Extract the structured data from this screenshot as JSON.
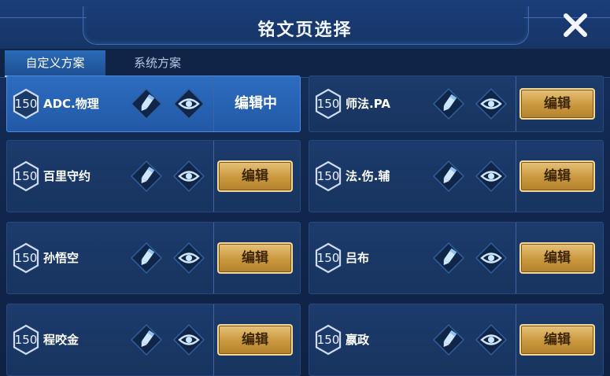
{
  "header": {
    "title": "铭文页选择"
  },
  "tabs": [
    {
      "label": "自定义方案",
      "active": true
    },
    {
      "label": "系统方案",
      "active": false
    }
  ],
  "pages": [
    {
      "level": "150",
      "name": "ADC.物理",
      "selected": true,
      "action_label": "编辑中"
    },
    {
      "level": "150",
      "name": "师法.PA",
      "selected": false,
      "action_label": "编辑"
    },
    {
      "level": "150",
      "name": "百里守约",
      "selected": false,
      "action_label": "编辑"
    },
    {
      "level": "150",
      "name": "法.伤.辅",
      "selected": false,
      "action_label": "编辑"
    },
    {
      "level": "150",
      "name": "孙悟空",
      "selected": false,
      "action_label": "编辑"
    },
    {
      "level": "150",
      "name": "吕布",
      "selected": false,
      "action_label": "编辑"
    },
    {
      "level": "150",
      "name": "程咬金",
      "selected": false,
      "action_label": "编辑"
    },
    {
      "level": "150",
      "name": "嬴政",
      "selected": false,
      "action_label": "编辑"
    }
  ],
  "icons": {
    "rename": "pencil-icon",
    "preview": "eye-icon",
    "close": "close-icon"
  },
  "colors": {
    "gold_button": "#c9983e",
    "selected_card": "#2a63b3",
    "card": "#1a3866"
  }
}
